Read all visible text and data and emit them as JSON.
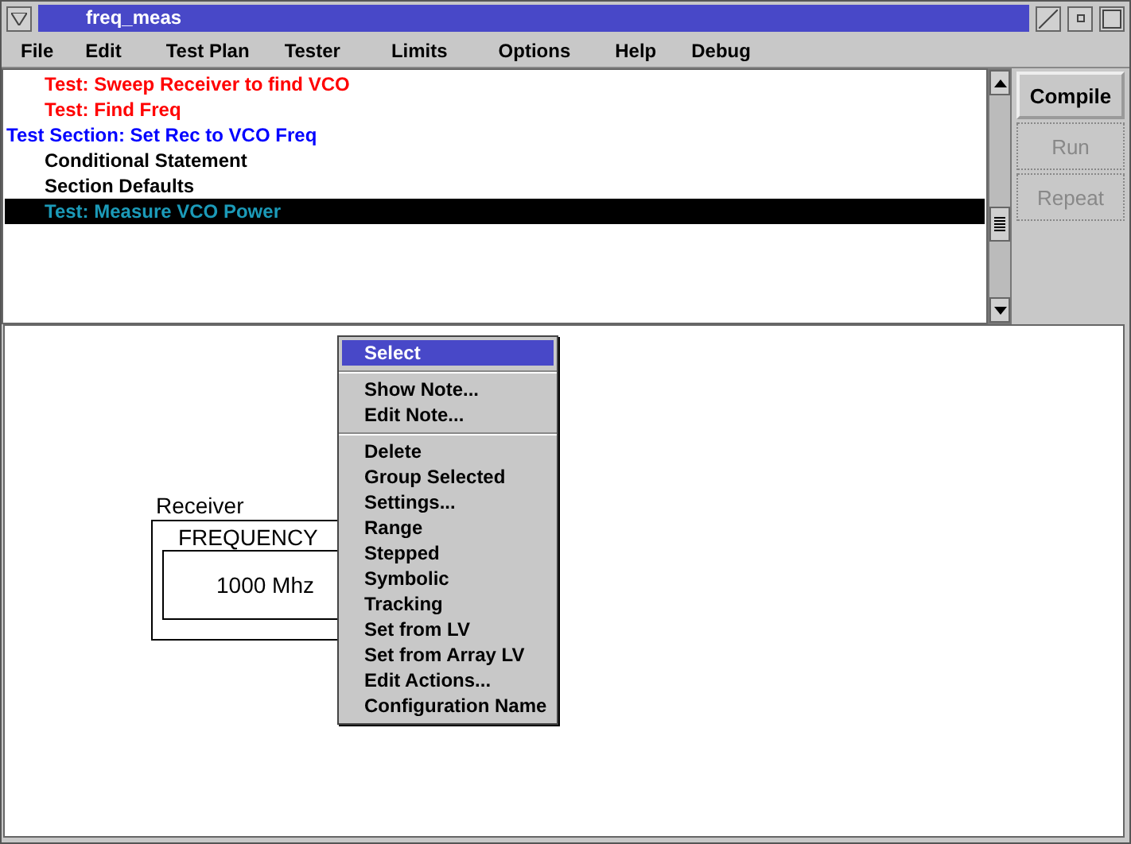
{
  "window": {
    "title": "freq_meas"
  },
  "menu_bar": [
    "File",
    "Edit",
    "Test Plan",
    "Tester",
    "Limits",
    "Options",
    "Help",
    "Debug"
  ],
  "outline": [
    {
      "kind": "test",
      "label": "Test: Sweep Receiver to find VCO",
      "selected": false
    },
    {
      "kind": "test",
      "label": "Test: Find Freq",
      "selected": false
    },
    {
      "kind": "section",
      "label": "Test Section: Set Rec to VCO Freq",
      "selected": false,
      "children": [
        {
          "kind": "statement",
          "label": "Conditional Statement",
          "selected": false
        },
        {
          "kind": "statement",
          "label": "Section Defaults",
          "selected": false
        },
        {
          "kind": "test",
          "label": "Test: Measure VCO Power",
          "selected": true
        }
      ]
    }
  ],
  "buttons": [
    {
      "label": "Compile",
      "disabled": false
    },
    {
      "label": "Run",
      "disabled": true
    },
    {
      "label": "Repeat",
      "disabled": true
    }
  ],
  "canvas": {
    "node": {
      "title": "Receiver",
      "field_label": "FREQUENCY",
      "value": "1000 Mhz"
    }
  },
  "context_menu": [
    [
      {
        "label": "Select",
        "selected": true
      }
    ],
    [
      {
        "label": "Show Note...",
        "selected": false
      },
      {
        "label": "Edit Note...",
        "selected": false
      }
    ],
    [
      {
        "label": "Delete",
        "selected": false
      },
      {
        "label": "Group Selected",
        "selected": false
      },
      {
        "label": "Settings...",
        "selected": false
      },
      {
        "label": "Range",
        "selected": false
      },
      {
        "label": "Stepped",
        "selected": false
      },
      {
        "label": "Symbolic",
        "selected": false
      },
      {
        "label": "Tracking",
        "selected": false
      },
      {
        "label": "Set from LV",
        "selected": false
      },
      {
        "label": "Set from Array LV",
        "selected": false
      },
      {
        "label": "Edit Actions...",
        "selected": false
      },
      {
        "label": "Configuration Name",
        "selected": false
      }
    ]
  ]
}
